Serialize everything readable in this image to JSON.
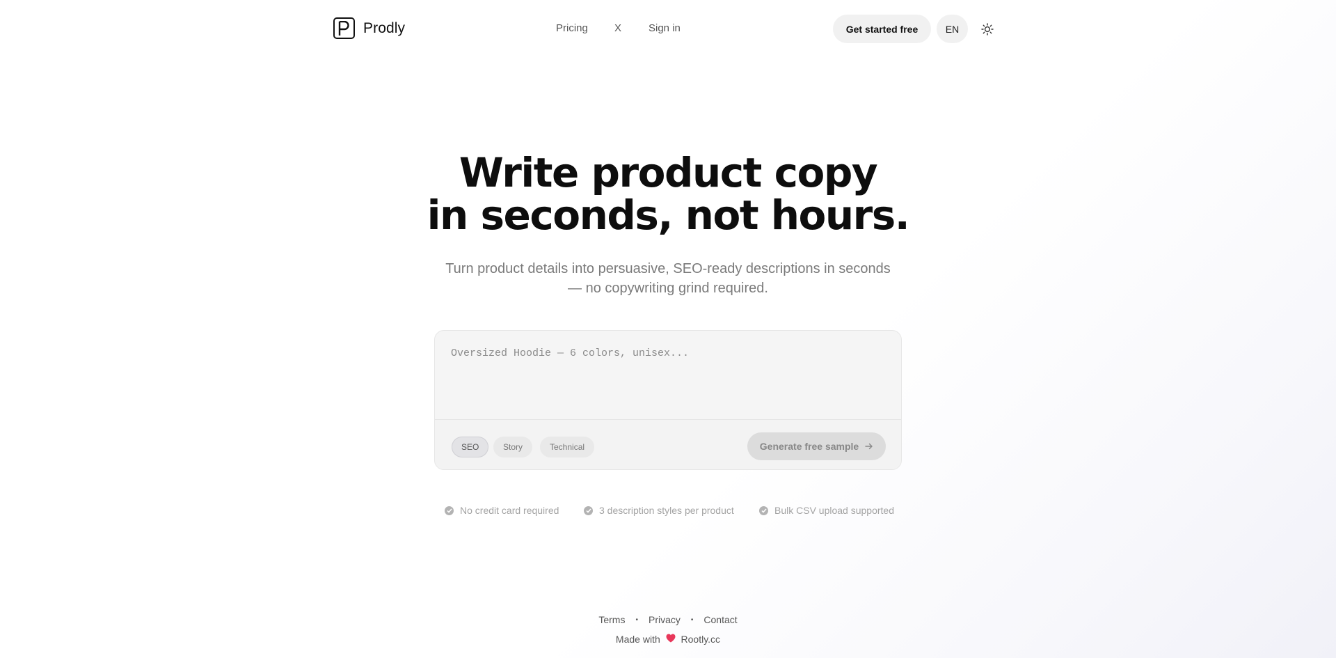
{
  "header": {
    "brand": "Prodly",
    "nav": {
      "pricing": "Pricing",
      "x": "X",
      "sign_in": "Sign in"
    },
    "cta_label": "Get started free",
    "language": "EN",
    "theme_icon": "sun-icon"
  },
  "hero": {
    "title_line1": "Write product copy",
    "title_line2": "in seconds, not hours.",
    "subtitle_line1": "Turn product details into persuasive, SEO-ready descriptions in seconds",
    "subtitle_line2": "— no copywriting grind required."
  },
  "composer": {
    "placeholder": "Oversized Hoodie — 6 colors, unisex...",
    "value": "",
    "styles": [
      {
        "label": "SEO",
        "selected": true
      },
      {
        "label": "Story",
        "selected": false
      },
      {
        "label": "Technical",
        "selected": false
      }
    ],
    "generate_label": "Generate free sample",
    "generate_icon": "arrow-right-icon"
  },
  "features": [
    "No credit card required",
    "3 description styles per product",
    "Bulk CSV upload supported"
  ],
  "footer": {
    "links": {
      "terms": "Terms",
      "privacy": "Privacy",
      "contact": "Contact"
    },
    "made_with_prefix": "Made with",
    "made_with_icon": "heart-icon",
    "made_with_link": "Rootly.cc"
  },
  "colors": {
    "heart": "#e8375a",
    "text_primary": "#0d0d0d",
    "text_muted": "#7a7a7a",
    "button_bg": "#f1f1f1"
  }
}
